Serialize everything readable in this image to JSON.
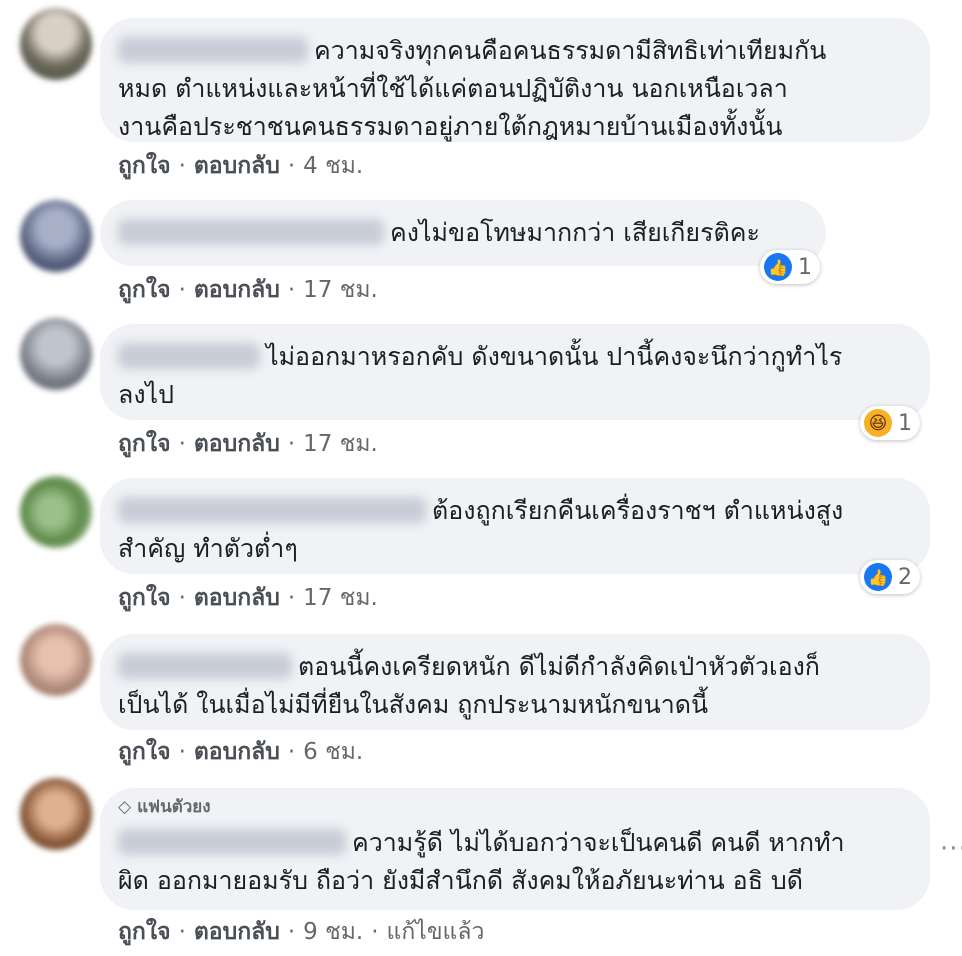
{
  "comments": [
    {
      "lines": [
        "ความจริงทุกคนคือคนธรรมดามีสิทธิเท่าเทียมกัน",
        "หมด ตำแหน่งและหน้าที่ใช้ได้แค่ตอนปฏิบัติงาน นอกเหนือเวลา",
        "งานคือประชาชนคนธรรมดาอยู่ภายใต้กฎหมายบ้านเมืองทั้งนั้น"
      ],
      "like": "ถูกใจ",
      "reply": "ตอบกลับ",
      "time": "4 ชม."
    },
    {
      "lines": [
        "คงไม่ขอโทษมากกว่า เสียเกียรติคะ"
      ],
      "like": "ถูกใจ",
      "reply": "ตอบกลับ",
      "time": "17 ชม.",
      "reaction": {
        "icon": "like-icon",
        "count": "1"
      }
    },
    {
      "lines": [
        "ไม่ออกมาหรอกคับ ดังขนาดนั้น ปานี้คงจะนึกว่ากูทำไร",
        "ลงไป"
      ],
      "like": "ถูกใจ",
      "reply": "ตอบกลับ",
      "time": "17 ชม.",
      "reaction": {
        "icon": "haha-icon",
        "count": "1"
      }
    },
    {
      "lines": [
        "ต้องถูกเรียกคืนเครื่องราชฯ ตำแหน่งสูง",
        "สำคัญ ทำตัวต่ำๆ"
      ],
      "like": "ถูกใจ",
      "reply": "ตอบกลับ",
      "time": "17 ชม.",
      "reaction": {
        "icon": "like-icon",
        "count": "2"
      }
    },
    {
      "lines": [
        "ตอนนี้คงเครียดหนัก ดีไม่ดีกำลังคิดเป่าหัวตัวเองก็",
        "เป็นได้ ในเมื่อไม่มีที่ยืนในสังคม ถูกประนามหนักขนาดนี้"
      ],
      "like": "ถูกใจ",
      "reply": "ตอบกลับ",
      "time": "6 ชม."
    },
    {
      "badge": "แฟนตัวยง",
      "lines": [
        "ความรู้ดี ไม่ได้บอกว่าจะเป็นคนดี คนดี หากทำ",
        "ผิด ออกมายอมรับ ถือว่า ยังมีสำนึกดี สังคมให้อภัยนะท่าน อธิ บดี"
      ],
      "like": "ถูกใจ",
      "reply": "ตอบกลับ",
      "time": "9 ชม.",
      "edited": "แก้ไขแล้ว",
      "more": "···"
    }
  ],
  "colors": {
    "bubble": "#f0f2f5",
    "meta": "#65676b",
    "like_blue": "#1877f2",
    "haha_yellow": "#f7b125"
  }
}
